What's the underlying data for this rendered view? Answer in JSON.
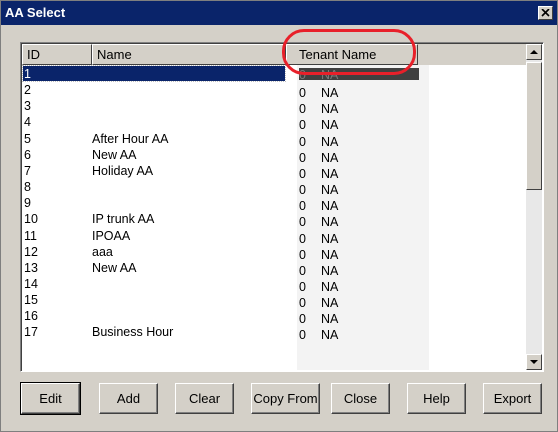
{
  "window": {
    "title": "AA Select"
  },
  "list": {
    "columns": {
      "id": "ID",
      "name": "Name",
      "tenant": "Tenant Name"
    },
    "rows": [
      {
        "id": "1",
        "name": "",
        "num": "0",
        "tenant": "NA",
        "selected": true
      },
      {
        "id": "2",
        "name": "",
        "num": "0",
        "tenant": "NA"
      },
      {
        "id": "3",
        "name": "",
        "num": "0",
        "tenant": "NA"
      },
      {
        "id": "4",
        "name": "",
        "num": "0",
        "tenant": "NA"
      },
      {
        "id": "5",
        "name": "After Hour AA",
        "num": "0",
        "tenant": "NA"
      },
      {
        "id": "6",
        "name": "New AA",
        "num": "0",
        "tenant": "NA"
      },
      {
        "id": "7",
        "name": "Holiday AA",
        "num": "0",
        "tenant": "NA"
      },
      {
        "id": "8",
        "name": "",
        "num": "0",
        "tenant": "NA"
      },
      {
        "id": "9",
        "name": "",
        "num": "0",
        "tenant": "NA"
      },
      {
        "id": "10",
        "name": "IP trunk AA",
        "num": "0",
        "tenant": "NA"
      },
      {
        "id": "11",
        "name": "IPOAA",
        "num": "0",
        "tenant": "NA"
      },
      {
        "id": "12",
        "name": "aaa",
        "num": "0",
        "tenant": "NA"
      },
      {
        "id": "13",
        "name": "New AA",
        "num": "0",
        "tenant": "NA"
      },
      {
        "id": "14",
        "name": "",
        "num": "0",
        "tenant": "NA"
      },
      {
        "id": "15",
        "name": "",
        "num": "0",
        "tenant": "NA"
      },
      {
        "id": "16",
        "name": "",
        "num": "0",
        "tenant": "NA"
      },
      {
        "id": "17",
        "name": "Business Hour",
        "num": "0",
        "tenant": "NA"
      }
    ]
  },
  "buttons": {
    "edit": "Edit",
    "add": "Add",
    "clear": "Clear",
    "copy_from": "Copy From",
    "close": "Close",
    "help": "Help",
    "export": "Export"
  },
  "icons": {
    "close": "close-icon",
    "scroll_up": "arrow-up-icon",
    "scroll_down": "arrow-down-icon"
  },
  "colors": {
    "titlebar": "#0a246a",
    "face": "#d4d0c8",
    "annotation": "#e8202a"
  }
}
